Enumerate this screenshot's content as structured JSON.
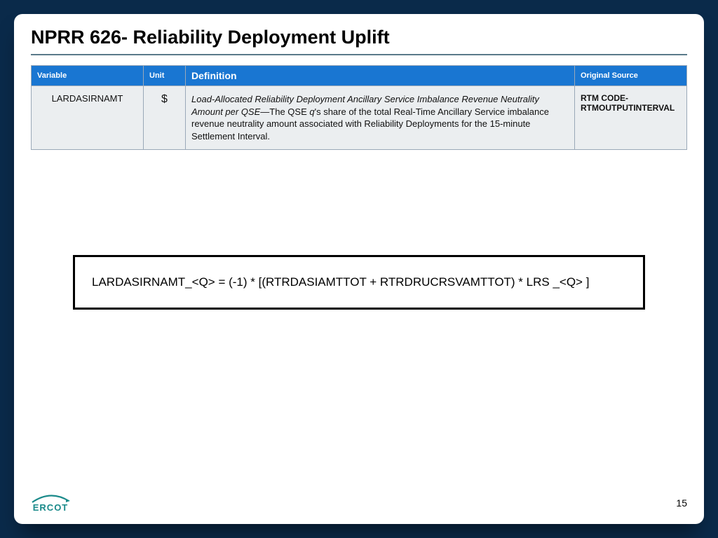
{
  "title": "NPRR 626- Reliability Deployment Uplift",
  "table": {
    "headers": {
      "variable": "Variable",
      "unit": "Unit",
      "definition": "Definition",
      "source": "Original Source"
    },
    "row": {
      "variable": "LARDASIRNAMT",
      "unit": "$",
      "def_em": "Load-Allocated Reliability Deployment Ancillary Service Imbalance Revenue Neutrality Amount per QSE",
      "def_sep": "—The QSE ",
      "def_q": "q",
      "def_rest": "'s share of the total Real-Time Ancillary Service imbalance revenue neutrality amount associated with Reliability Deployments for the 15-minute Settlement Interval.",
      "source": "RTM CODE-RTMOUTPUTINTERVAL"
    }
  },
  "formula": "LARDASIRNAMT_<Q> =      (-1) * [(RTRDASIAMTTOT + RTRDRUCRSVAMTTOT) * LRS _<Q> ]",
  "logo": "ERCOT",
  "page": "15"
}
